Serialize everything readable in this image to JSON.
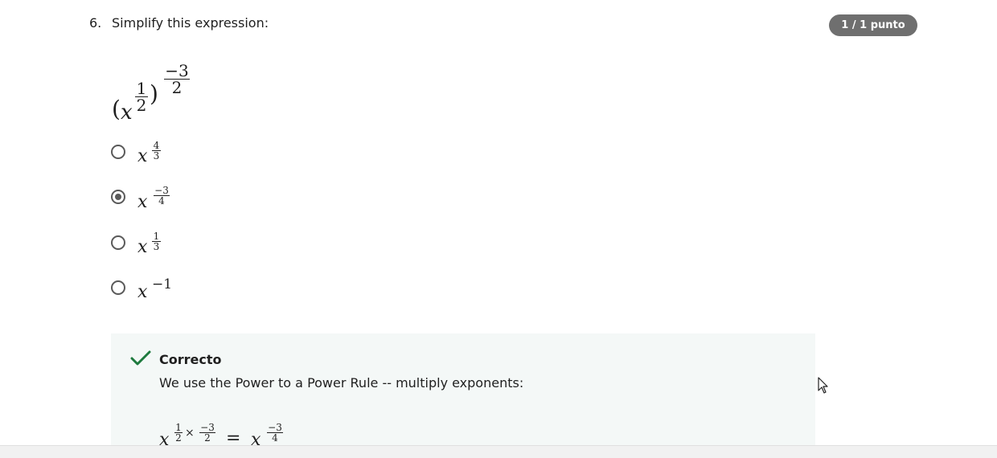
{
  "question": {
    "number": "6.",
    "text": "Simplify this expression:",
    "score": "1 / 1 punto",
    "expression": {
      "open_paren": "(",
      "base": "x",
      "inner_num": "1",
      "inner_den": "2",
      "close_paren": ")",
      "outer_num": "−3",
      "outer_den": "2"
    }
  },
  "options": [
    {
      "base": "x",
      "num": "4",
      "den": "3",
      "selected": false
    },
    {
      "base": "x",
      "num": "−3",
      "den": "4",
      "selected": true
    },
    {
      "base": "x",
      "num": "1",
      "den": "3",
      "selected": false
    },
    {
      "base": "x",
      "exponent": "−1",
      "selected": false
    }
  ],
  "feedback": {
    "title": "Correcto",
    "text": "We use the Power to a Power Rule -- multiply exponents:",
    "equation": {
      "base": "x",
      "a_num": "1",
      "a_den": "2",
      "times": "×",
      "b_num": "−3",
      "b_den": "2",
      "equals": "=",
      "rhs_base": "x",
      "rhs_num": "−3",
      "rhs_den": "4"
    }
  },
  "colors": {
    "badge_bg": "#6f6f6f",
    "feedback_bg": "#f4f8f7",
    "check": "#1e7a3e",
    "radio": "#5a5a5a"
  },
  "icons": {
    "check": "check-icon",
    "cursor": "mouse-pointer-icon"
  }
}
